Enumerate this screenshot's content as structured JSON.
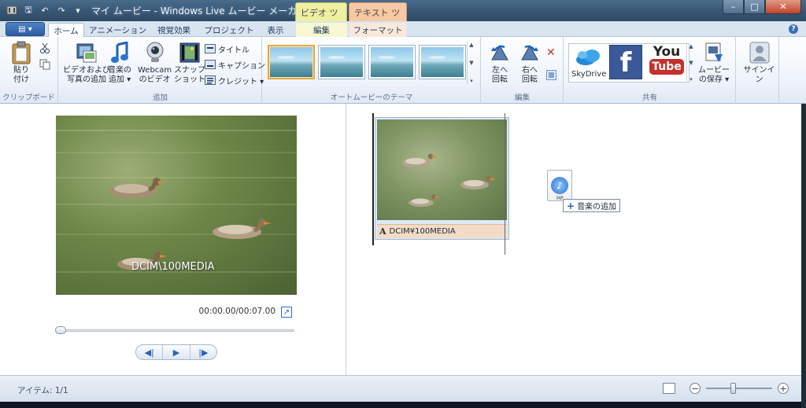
{
  "window": {
    "title": "マイ ムービー - Windows Live ムービー メーカー",
    "context_video": "ビデオ ツール",
    "context_text": "テキスト ツール",
    "min": "–",
    "max": "□",
    "close": "✕"
  },
  "qat": {
    "save": "🖫",
    "undo": "↶",
    "redo": "↷",
    "more": "▾"
  },
  "app_menu": {
    "label": "▤ ▾"
  },
  "tabs": [
    {
      "label": "ホーム"
    },
    {
      "label": "アニメーション"
    },
    {
      "label": "視覚効果"
    },
    {
      "label": "プロジェクト"
    },
    {
      "label": "表示"
    },
    {
      "label": "編集"
    },
    {
      "label": "フォーマット"
    }
  ],
  "help": "?",
  "ribbon": {
    "clipboard": {
      "label": "クリップボード",
      "paste": "貼り\n付け"
    },
    "add": {
      "label": "追加",
      "add_video": "ビデオおよび\n写真の追加",
      "add_music": "音楽の\n追加 ▾",
      "webcam": "Webcam\nのビデオ",
      "snapshot": "スナップ\nショット",
      "title": "タイトル",
      "caption": "キャプション",
      "credits": "クレジット ▾"
    },
    "themes": {
      "label": "オートムービーのテーマ"
    },
    "edit": {
      "label": "編集",
      "rotate_left": "左へ\n回転",
      "rotate_right": "右へ\n回転"
    },
    "share": {
      "label": "共有",
      "skydrive": "SkyDrive",
      "facebook": "f",
      "youtube_top": "You",
      "youtube_bottom": "Tube",
      "save_movie": "ムービー\nの保存 ▾"
    },
    "signin": {
      "label": "サインイン"
    }
  },
  "preview": {
    "caption": "DCIM\\100MEDIA",
    "timecode": "00:00.00/00:07.00",
    "prev_frame": "◀|",
    "play": "▶",
    "next_frame": "|▶"
  },
  "storyboard": {
    "clip_caption": "DCIM¥100MEDIA",
    "clip_caption_icon": "A",
    "drag_file_ext": "MP",
    "drag_tip": "音楽の追加"
  },
  "status": {
    "items": "アイテム: 1/1",
    "zoom_level": 0.4
  },
  "colors": {
    "titlebar": "#3a5877",
    "ribbon": "#eef3fa",
    "accent": "#2b6bc4",
    "facebook": "#3b5998",
    "youtube": "#c4302b"
  }
}
